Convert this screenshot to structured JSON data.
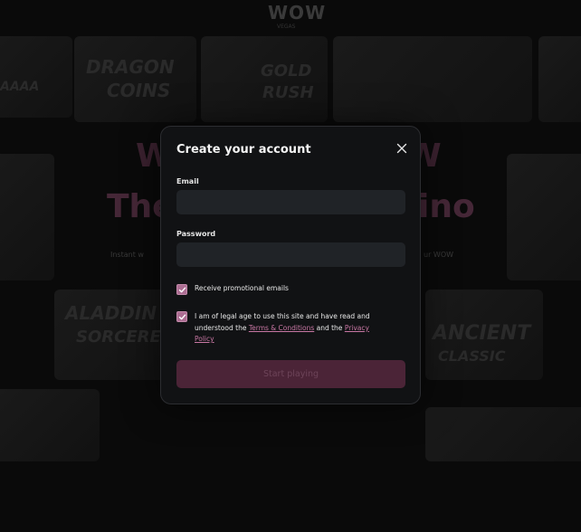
{
  "background": {
    "brand": "WOW",
    "brand_sub": "VEGAS",
    "tiles": [
      "DRAGON",
      "COINS",
      "GOLD",
      "RUSH",
      "AAAA",
      "ALADDIN",
      "SORCERER",
      "ANCIENT",
      "CLASSIC"
    ],
    "hero_line1_left": "W",
    "hero_line1_right": "W",
    "hero_line2_left": "The",
    "hero_line2_right": "ino",
    "hero_sub_left": "Instant w",
    "hero_sub_right": "ur WOW"
  },
  "modal": {
    "title": "Create your account",
    "email_label": "Email",
    "email_value": "",
    "password_label": "Password",
    "password_value": "",
    "promo_label": "Receive promotional emails",
    "promo_checked": true,
    "legal_text_1": "I am of legal age to use this site and have read and understood the ",
    "terms_link": "Terms & Conditions",
    "legal_text_2": " and the ",
    "privacy_link_1": "Privacy",
    "privacy_link_2": "Policy",
    "legal_checked": true,
    "submit_label": "Start playing"
  },
  "colors": {
    "accent": "#ac6d92",
    "link": "#c877a4",
    "cta_disabled_bg": "#4b2437",
    "modal_bg": "#111214",
    "input_bg": "#202327"
  }
}
